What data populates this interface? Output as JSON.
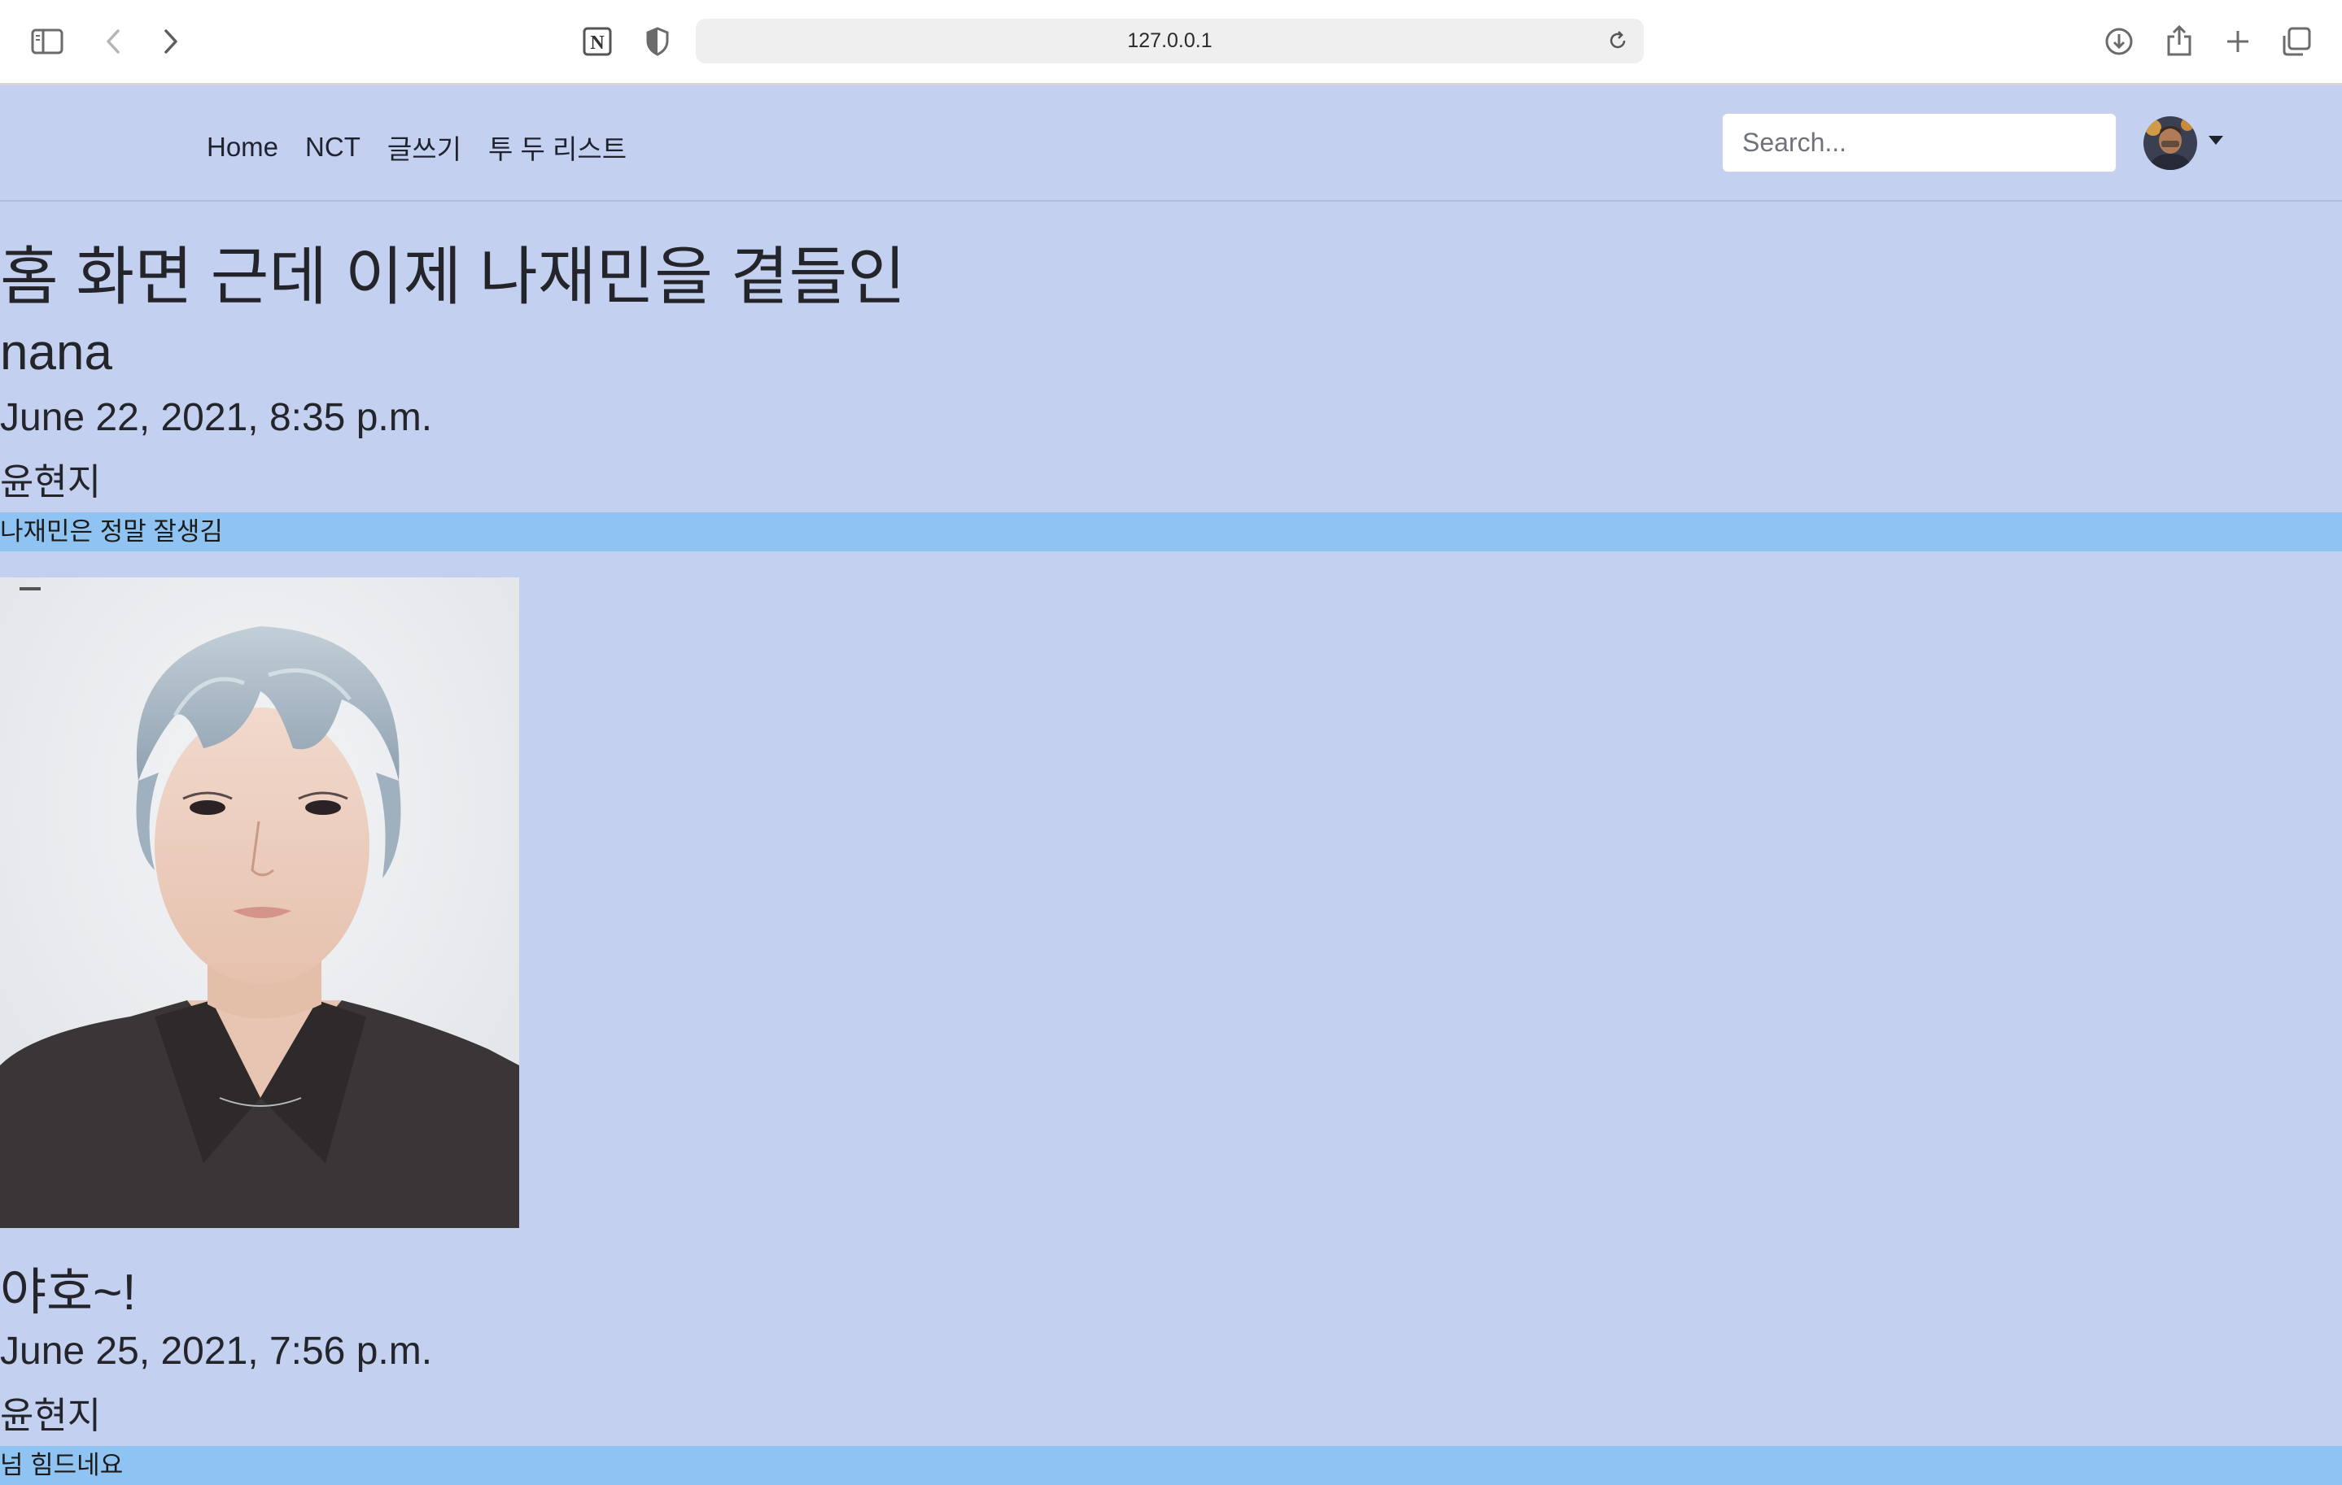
{
  "browser": {
    "url": "127.0.0.1",
    "icons": [
      "sidebar-toggle-icon",
      "back-arrow-icon",
      "forward-arrow-icon",
      "notion-icon",
      "shield-icon",
      "reload-icon",
      "download-icon",
      "share-icon",
      "new-tab-plus-icon",
      "tab-overview-icon"
    ]
  },
  "navbar": {
    "links": [
      "Home",
      "NCT",
      "글쓰기",
      "투 두 리스트"
    ],
    "search_placeholder": "Search..."
  },
  "page": {
    "title": "홈 화면 근데 이제 나재민을 곁들인"
  },
  "posts": [
    {
      "title": "nana",
      "date": "June 22, 2021, 8:35 p.m.",
      "author": "윤현지",
      "body": "나재민은 정말 잘생김",
      "has_image": true
    },
    {
      "title": "야호~!",
      "date": "June 25, 2021, 7:56 p.m.",
      "author": "윤현지",
      "body": "넘 힘드네요"
    }
  ],
  "colors": {
    "page_background": "#c4d0ef",
    "post_body_band": "#8ec3f2"
  }
}
